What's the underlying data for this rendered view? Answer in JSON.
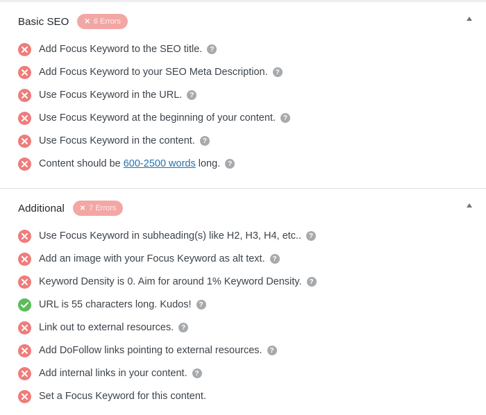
{
  "basic_seo": {
    "title": "Basic SEO",
    "badge": "6 Errors",
    "items": [
      {
        "text": "Add Focus Keyword to the SEO title.",
        "status": "fail"
      },
      {
        "text": "Add Focus Keyword to your SEO Meta Description.",
        "status": "fail"
      },
      {
        "text": "Use Focus Keyword in the URL.",
        "status": "fail"
      },
      {
        "text": "Use Focus Keyword at the beginning of your content.",
        "status": "fail"
      },
      {
        "text": "Use Focus Keyword in the content.",
        "status": "fail"
      },
      {
        "text_before": "Content should be ",
        "link": "600-2500 words",
        "text_after": " long.",
        "status": "fail"
      }
    ]
  },
  "additional": {
    "title": "Additional",
    "badge": "7 Errors",
    "items": [
      {
        "text": "Use Focus Keyword in subheading(s) like H2, H3, H4, etc..",
        "status": "fail"
      },
      {
        "text": "Add an image with your Focus Keyword as alt text.",
        "status": "fail"
      },
      {
        "text": "Keyword Density is 0. Aim for around 1% Keyword Density.",
        "status": "fail"
      },
      {
        "text": "URL is 55 characters long. Kudos!",
        "status": "pass"
      },
      {
        "text": "Link out to external resources.",
        "status": "fail"
      },
      {
        "text": "Add DoFollow links pointing to external resources.",
        "status": "fail"
      },
      {
        "text": "Add internal links in your content.",
        "status": "fail"
      },
      {
        "text": "Set a Focus Keyword for this content.",
        "status": "fail"
      }
    ]
  },
  "icons": {
    "fail": "x-circle-icon",
    "pass": "check-circle-icon",
    "help": "help-icon",
    "badge": "x-icon",
    "collapse": "caret-up-icon"
  },
  "colors": {
    "fail": "#ee7d7b",
    "pass": "#5bbd5a",
    "badge_bg": "#f2a7a5",
    "link": "#2271b1",
    "help": "#a7aaad"
  }
}
